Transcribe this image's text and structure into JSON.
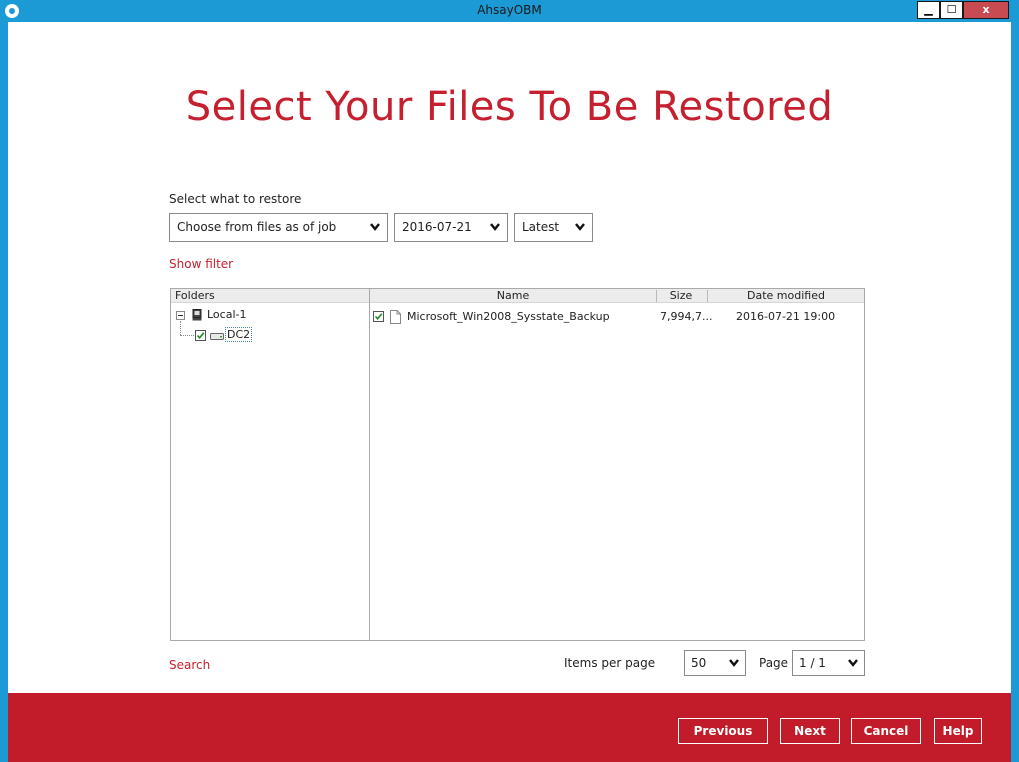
{
  "window": {
    "title": "AhsayOBM",
    "minimize_label": "▁",
    "maximize_label": "☐",
    "close_label": "x"
  },
  "page": {
    "title": "Select Your Files To Be Restored",
    "select_label": "Select what to restore",
    "show_filter": "Show filter",
    "search": "Search"
  },
  "dropdowns": {
    "job_mode": "Choose from files as of job",
    "date": "2016-07-21",
    "version": "Latest"
  },
  "tree": {
    "header": "Folders",
    "root": "Local-1",
    "child": "DC2"
  },
  "files": {
    "columns": [
      "Name",
      "Size",
      "Date modified"
    ],
    "rows": [
      {
        "name": "Microsoft_Win2008_Sysstate_Backup",
        "size": "7,994,7...",
        "modified": "2016-07-21 19:00"
      }
    ]
  },
  "pager": {
    "items_label": "Items per page",
    "items_value": "50",
    "page_label": "Page",
    "page_value": "1 / 1"
  },
  "buttons": {
    "previous": "Previous",
    "next": "Next",
    "cancel": "Cancel",
    "help": "Help"
  },
  "colors": {
    "accent": "#c5202f",
    "titlebar": "#1b9ad6",
    "footer": "#c21c2b"
  }
}
